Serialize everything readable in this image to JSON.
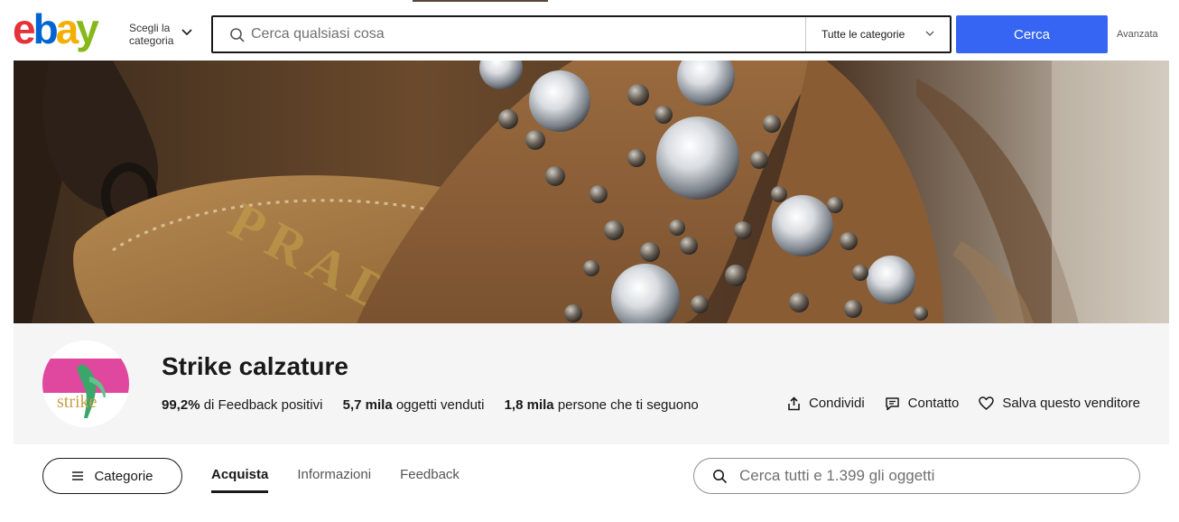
{
  "header": {
    "logo_letters": [
      "e",
      "b",
      "a",
      "y"
    ],
    "logo_colors": [
      "#e53238",
      "#0064d2",
      "#f5af02",
      "#86b817"
    ],
    "shop_by_label": "Scegli la categoria",
    "search_placeholder": "Cerca qualsiasi cosa",
    "category_select_value": "Tutte le categorie",
    "search_button_label": "Cerca",
    "advanced_label": "Avanzata"
  },
  "banner": {
    "brand_text": "PRADA"
  },
  "seller": {
    "avatar_text": "strike",
    "store_name": "Strike calzature",
    "stats": [
      {
        "value": "99,2%",
        "label": "di Feedback positivi"
      },
      {
        "value": "5,7 mila",
        "label": "oggetti venduti"
      },
      {
        "value": "1,8 mila",
        "label": "persone che ti seguono"
      }
    ],
    "actions": {
      "share_label": "Condividi",
      "contact_label": "Contatto",
      "save_label": "Salva questo venditore"
    }
  },
  "nav": {
    "categories_label": "Categorie",
    "tabs": [
      {
        "label": "Acquista",
        "active": true
      },
      {
        "label": "Informazioni",
        "active": false
      },
      {
        "label": "Feedback",
        "active": false
      }
    ],
    "store_search_placeholder": "Cerca tutti e 1.399 gli oggetti"
  },
  "colors": {
    "accent": "#3665f3",
    "text": "#191919",
    "seller_bg": "#f5f5f5"
  }
}
